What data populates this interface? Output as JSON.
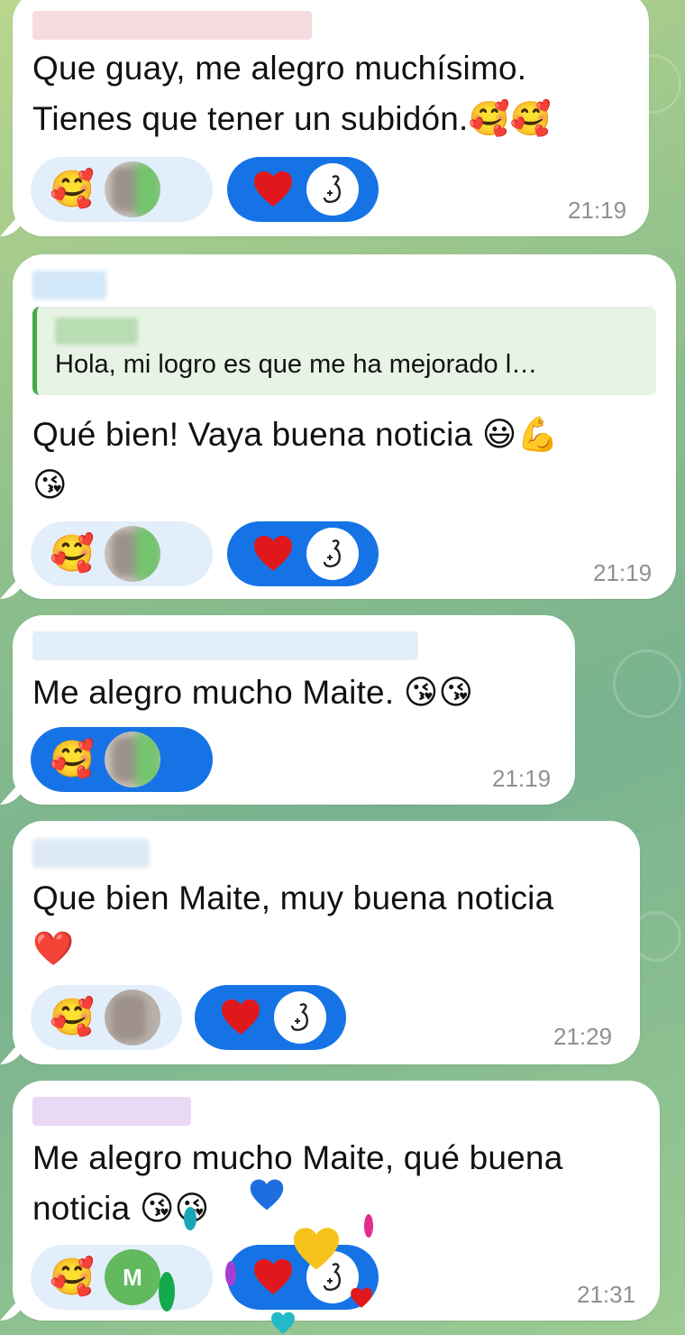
{
  "messages": [
    {
      "text_line1": "Que guay, me alegro muchísimo.",
      "text_line2": "Tienes que tener un subidón.🥰🥰",
      "time": "21:19",
      "reaction_emoji": "🥰"
    },
    {
      "reply_text": "Hola, mi logro es que me ha mejorado l…",
      "text_line1": "Qué bien! Vaya buena noticia 😃💪",
      "text_line2": "😘",
      "time": "21:19",
      "reaction_emoji": "🥰"
    },
    {
      "text_line1": "Me alegro mucho Maite. 😘😘",
      "time": "21:19",
      "reaction_emoji": "🥰"
    },
    {
      "text_line1": "Que bien Maite, muy buena noticia",
      "text_line2": "❤️",
      "time": "21:29",
      "reaction_emoji": "🥰"
    },
    {
      "text_line1": "Me alegro mucho Maite, qué buena",
      "text_line2": "noticia 😘😘",
      "time": "21:31",
      "reaction_emoji": "🥰",
      "avatar_letter": "M"
    }
  ],
  "icons": {
    "heart": "heart-icon",
    "arm": "flexed-arm-icon"
  },
  "colors": {
    "reaction_blue": "#1673e6",
    "heart_red": "#e0181b",
    "reply_bar": "#48a94a"
  }
}
